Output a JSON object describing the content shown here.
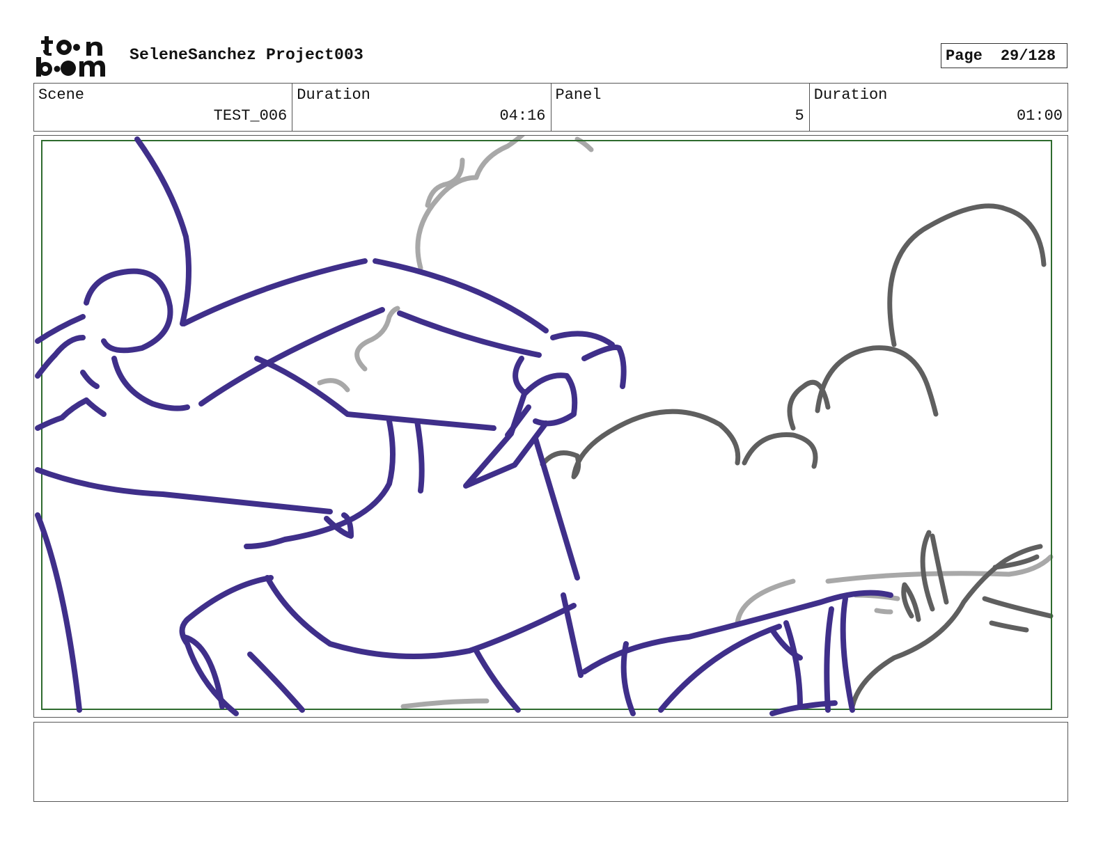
{
  "header": {
    "logo_text_top": "toon",
    "logo_text_bottom": "boom",
    "project_title": "SeleneSanchez Project003",
    "page_label": "Page",
    "page_value": "29/128"
  },
  "info": {
    "scene_label": "Scene",
    "scene_value": "TEST_006",
    "scene_duration_label": "Duration",
    "scene_duration_value": "04:16",
    "panel_label": "Panel",
    "panel_value": "5",
    "panel_duration_label": "Duration",
    "panel_duration_value": "01:00"
  },
  "colors": {
    "character_line": "#3f2f8a",
    "smoke_dark": "#5f5f5f",
    "smoke_light": "#a8a8a8",
    "safe_frame": "#2e6b2e",
    "border": "#555555"
  },
  "notes": {
    "text": ""
  }
}
